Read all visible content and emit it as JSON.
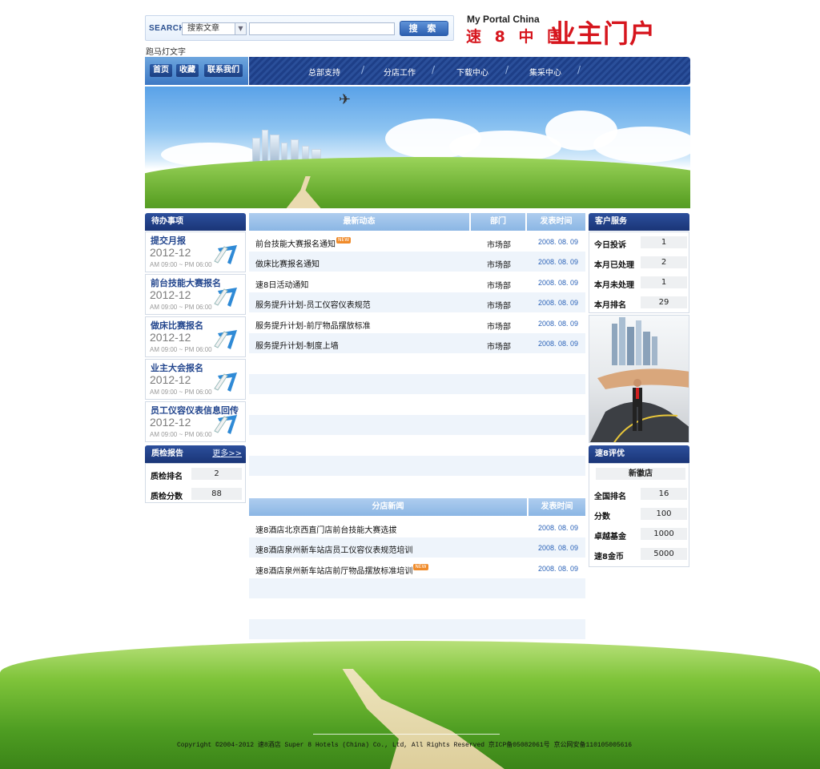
{
  "search": {
    "label": "SEARCH",
    "select_value": "搜索文章",
    "input_value": "",
    "button": "搜 索"
  },
  "marquee": "跑马灯文字",
  "brand": {
    "en": "My Portal China",
    "cn": "速 8 中 国",
    "big": "业主门户"
  },
  "nav_left": [
    "首页",
    "收藏",
    "联系我们"
  ],
  "nav_right": [
    "总部支持",
    "分店工作",
    "下载中心",
    "集采中心"
  ],
  "todo": {
    "title": "待办事项",
    "items": [
      {
        "title": "提交月报",
        "date": "2012-12",
        "hours": "AM 09:00 ~ PM 06:00"
      },
      {
        "title": "前台技能大赛报名",
        "date": "2012-12",
        "hours": "AM 09:00 ~ PM 06:00"
      },
      {
        "title": "做床比赛报名",
        "date": "2012-12",
        "hours": "AM 09:00 ~ PM 06:00"
      },
      {
        "title": "业主大会报名",
        "date": "2012-12",
        "hours": "AM 09:00 ~ PM 06:00"
      },
      {
        "title": "员工仪容仪表信息回传",
        "date": "2012-12",
        "hours": "AM 09:00 ~ PM 06:00"
      }
    ]
  },
  "quality": {
    "title": "质检报告",
    "more": "更多>>",
    "rows": [
      {
        "k": "质检排名",
        "v": "2"
      },
      {
        "k": "质检分数",
        "v": "88"
      }
    ]
  },
  "latest": {
    "headers": [
      "最新动态",
      "部门",
      "发表时间"
    ],
    "rows": [
      {
        "title": "前台技能大赛报名通知",
        "new": true,
        "dept": "市场部",
        "date": "2008. 08. 09"
      },
      {
        "title": "做床比赛报名通知",
        "new": false,
        "dept": "市场部",
        "date": "2008. 08. 09"
      },
      {
        "title": "速8日活动通知",
        "new": false,
        "dept": "市场部",
        "date": "2008. 08. 09"
      },
      {
        "title": "服务提升计划-员工仪容仪表规范",
        "new": false,
        "dept": "市场部",
        "date": "2008. 08. 09"
      },
      {
        "title": "服务提升计划-前厅物品摆放标准",
        "new": false,
        "dept": "市场部",
        "date": "2008. 08. 09"
      },
      {
        "title": "服务提升计划-制度上墙",
        "new": false,
        "dept": "市场部",
        "date": "2008. 08. 09"
      }
    ]
  },
  "branch_news": {
    "headers": [
      "分店新闻",
      "发表时间"
    ],
    "rows": [
      {
        "title": "速8酒店北京西直门店前台技能大赛选拔",
        "new": false,
        "date": "2008. 08. 09"
      },
      {
        "title": "速8酒店泉州新车站店员工仪容仪表规范培训",
        "new": false,
        "date": "2008. 08. 09"
      },
      {
        "title": "速8酒店泉州新车站店前厅物品摆放标准培训",
        "new": true,
        "date": "2008. 08. 09"
      }
    ]
  },
  "new_badge": "NEW",
  "customer": {
    "title": "客户服务",
    "rows": [
      {
        "k": "今日投诉",
        "v": "1"
      },
      {
        "k": "本月已处理",
        "v": "2"
      },
      {
        "k": "本月未处理",
        "v": "1"
      },
      {
        "k": "本月排名",
        "v": "29"
      }
    ]
  },
  "rating": {
    "title": "速8评优",
    "store": "新徽店",
    "rows": [
      {
        "k": "全国排名",
        "v": "16"
      },
      {
        "k": "分数",
        "v": "100"
      },
      {
        "k": "卓越基金",
        "v": "1000"
      },
      {
        "k": "速8金币",
        "v": "5000"
      }
    ]
  },
  "footer": "Copyright ©2004-2012 速8酒店 Super 8 Hotels (China) Co., Ltd, All Rights Reserved 京ICP备05082061号 京公网安备110105005616",
  "colors": {
    "navy": "#1e3f88",
    "light_blue": "#9cc2eb",
    "brand_red": "#d6151d",
    "date_blue": "#2a62b8",
    "new_orange": "#f08b2a"
  }
}
